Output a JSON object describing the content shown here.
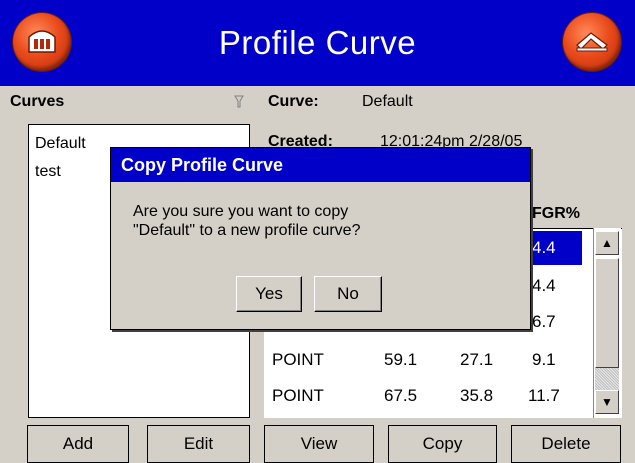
{
  "header": {
    "title": "Profile Curve",
    "left_icon": "home-icon",
    "right_icon": "exit-icon",
    "accent_color": "#0000c8",
    "button_color": "#ea4a1a"
  },
  "curves_panel": {
    "label": "Curves",
    "sort_icon": "filter-icon",
    "items": [
      "Default",
      "test"
    ]
  },
  "details": {
    "curve_label": "Curve:",
    "curve_value": "Default",
    "created_label": "Created:",
    "created_value": "12:01:24pm  2/28/05",
    "fgr_header": "FGR%"
  },
  "table": {
    "rows": [
      {
        "type": "",
        "a": "",
        "b": "",
        "fgr": "4.4",
        "selected": true
      },
      {
        "type": "",
        "a": "",
        "b": "",
        "fgr": "4.4"
      },
      {
        "type": "",
        "a": "",
        "b": "",
        "fgr": "6.7"
      },
      {
        "type": "POINT",
        "a": "59.1",
        "b": "27.1",
        "fgr": "9.1"
      },
      {
        "type": "POINT",
        "a": "67.5",
        "b": "35.8",
        "fgr": "11.7"
      }
    ]
  },
  "buttons": {
    "add": "Add",
    "edit": "Edit",
    "view": "View",
    "copy": "Copy",
    "delete": "Delete"
  },
  "dialog": {
    "title": "Copy Profile Curve",
    "message_line1": "Are you sure you want to copy",
    "message_line2": "\"Default\" to a new profile curve?",
    "yes": "Yes",
    "no": "No"
  }
}
